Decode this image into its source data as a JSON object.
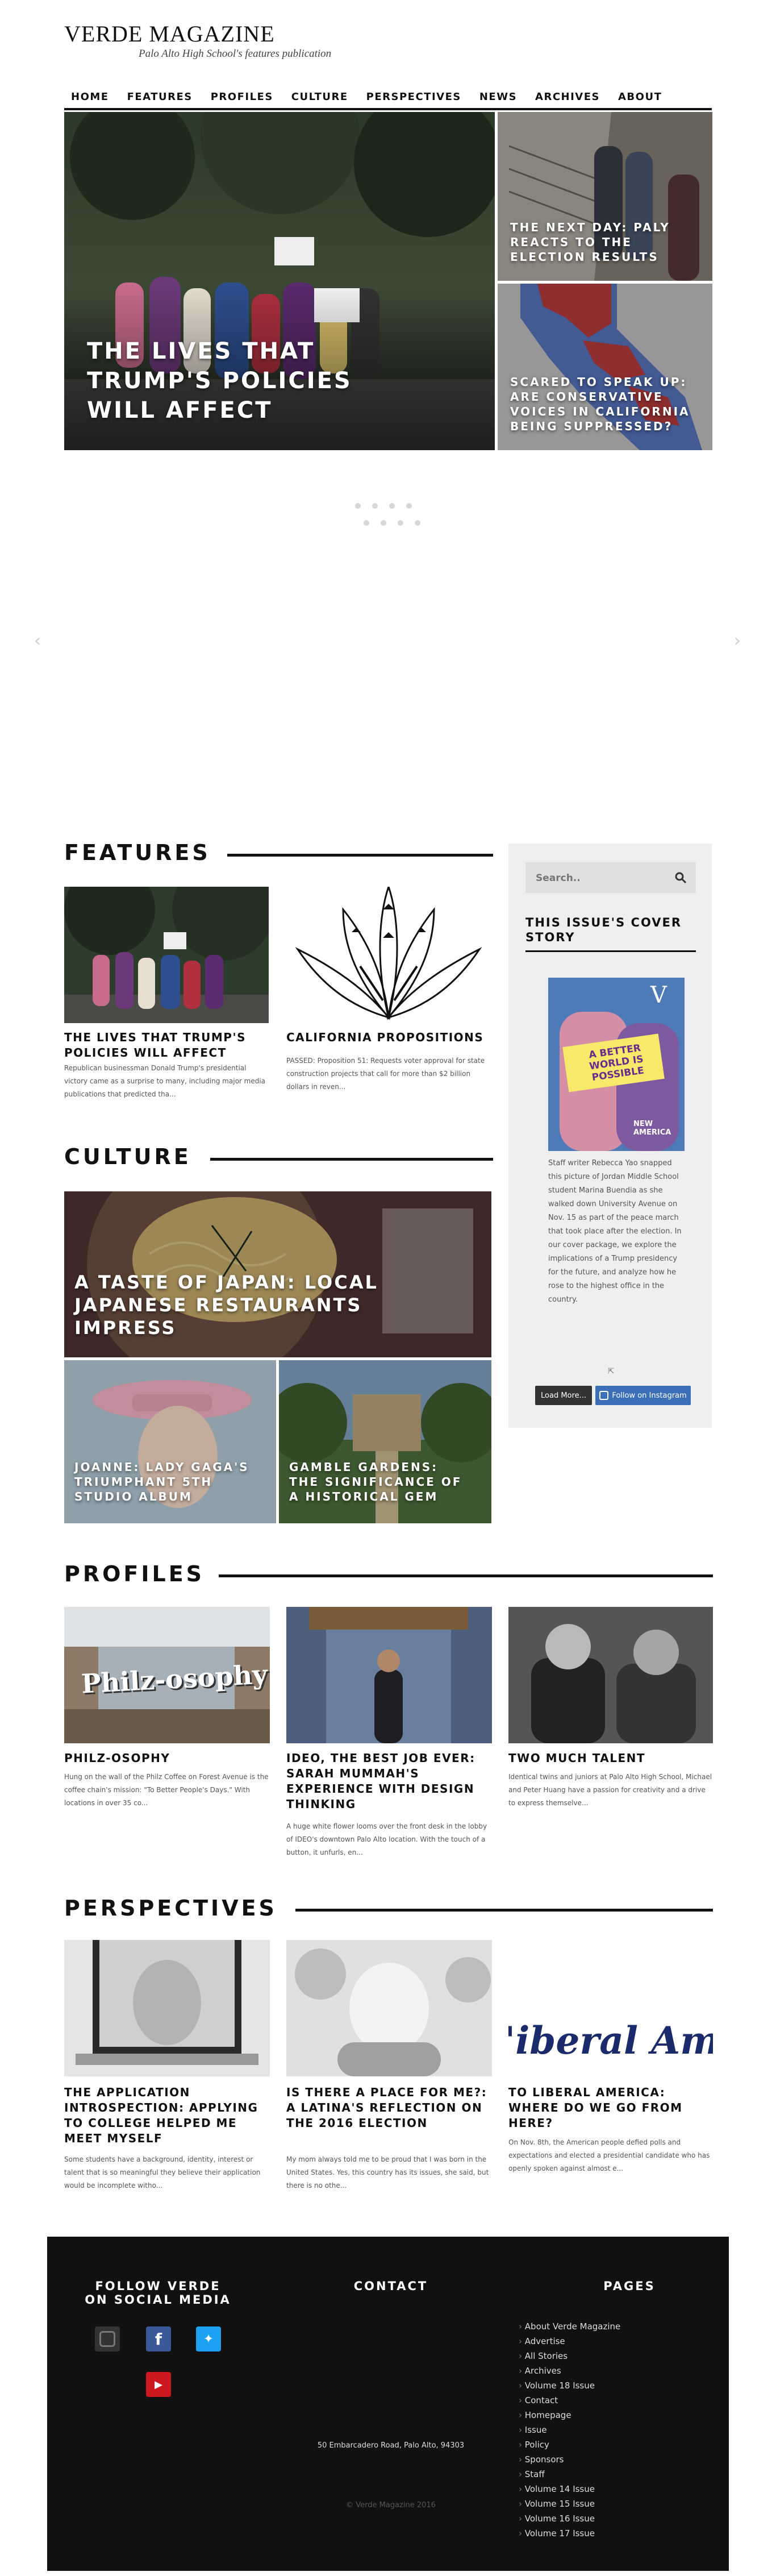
{
  "masthead": {
    "logo": "VERDE MAGAZINE",
    "tagline": "Palo Alto High School's features publication"
  },
  "nav": [
    "HOME",
    "FEATURES",
    "PROFILES",
    "CULTURE",
    "PERSPECTIVES",
    "NEWS",
    "ARCHIVES",
    "ABOUT"
  ],
  "hero": {
    "main": "THE LIVES THAT TRUMP'S POLICIES WILL AFFECT",
    "side1": "THE NEXT DAY: PALY REACTS TO THE ELECTION RESULTS",
    "side2": "SCARED TO SPEAK UP: ARE CONSERVATIVE VOICES IN CALIFORNIA BEING SUPPRESSED?"
  },
  "slider": {
    "prev": "‹",
    "next": "›"
  },
  "features": {
    "heading": "FEATURES",
    "cards": [
      {
        "title": "THE LIVES THAT TRUMP'S POLICIES WILL AFFECT",
        "excerpt": "Republican businessman Donald Trump's presidential victory came as a surprise to many, including major media publications that predicted tha..."
      },
      {
        "title": "CALIFORNIA PROPOSITIONS",
        "excerpt": "PASSED: Proposition 51: Requests voter approval for state construction projects that call for more than $2 billion dollars in reven..."
      }
    ]
  },
  "culture": {
    "heading": "CULTURE",
    "main": "A TASTE OF JAPAN: LOCAL JAPANESE RESTAURANTS IMPRESS",
    "left": "JOANNE: LADY GAGA'S TRIUMPHANT 5TH STUDIO ALBUM",
    "right": "GAMBLE GARDENS: THE SIGNIFICANCE OF A HISTORICAL GEM"
  },
  "sidebar": {
    "search_placeholder": "Search..",
    "cover_heading": "THIS ISSUE'S COVER STORY",
    "cover_text": "Staff writer Rebecca Yao snapped this picture of Jordan Middle School student Marina Buendia as she walked down University Avenue on Nov. 15 as part of the peace march that took place after the election. In our cover package, we explore the implications of a Trump presidency for the future, and analyze how he rose to the highest office in the country.",
    "cover_sign": "A BETTER WORLD IS POSSIBLE",
    "cover_letter": "V",
    "cover_badge": "NEW AMERICA",
    "load_more": "Load More...",
    "follow": "Follow on Instagram"
  },
  "profiles": {
    "heading": "PROFILES",
    "cards": [
      {
        "title": "PHILZ-OSOPHY",
        "excerpt": "Hung on the wall of the Philz Coffee on Forest Avenue is the coffee chain's mission: \"To Better People's Days.\" With locations in over 35 co...",
        "sign": "Philz-osophy"
      },
      {
        "title": "IDEO, THE BEST JOB EVER: SARAH MUMMAH'S EXPERIENCE WITH DESIGN THINKING",
        "excerpt": "A huge white flower looms over the front desk in the lobby of IDEO's downtown Palo Alto location. With the touch of a button, it unfurls, en..."
      },
      {
        "title": "TWO MUCH TALENT",
        "excerpt": "Identical twins and juniors at Palo Alto High School, Michael and Peter Huang have a passion for creativity and a drive to express themselve..."
      }
    ]
  },
  "perspectives": {
    "heading": "PERSPECTIVES",
    "cards": [
      {
        "title": "THE APPLICATION INTROSPECTION: APPLYING TO COLLEGE HELPED ME MEET MYSELF",
        "excerpt": "Some students have a background, identity, interest or talent that is so meaningful they believe their application would be incomplete witho..."
      },
      {
        "title": "IS THERE A PLACE FOR ME?: A LATINA'S REFLECTION ON THE 2016 ELECTION",
        "excerpt": "My mom always told me to be proud that I was born in the United States. Yes, this country has its issues, she said, but there is no othe..."
      },
      {
        "title": "TO LIBERAL AMERICA: WHERE DO WE GO FROM HERE?",
        "excerpt": "On Nov. 8th, the American people defied polls and expectations and elected a presidential candidate who has openly spoken against almost e...",
        "script": "'iberal Am"
      }
    ]
  },
  "footer": {
    "social_heading": "FOLLOW VERDE ON SOCIAL MEDIA",
    "contact_heading": "CONTACT",
    "pages_heading": "PAGES",
    "address": "50 Embarcadero Road, Palo Alto, 94303",
    "copyright": "© Verde Magazine 2016",
    "pages": [
      "About Verde Magazine",
      "Advertise",
      "All Stories",
      "Archives",
      "Volume 18 Issue",
      "Contact",
      "Homepage",
      "Issue",
      "Policy",
      "Sponsors",
      "Staff",
      "Volume 14 Issue",
      "Volume 15 Issue",
      "Volume 16 Issue",
      "Volume 17 Issue"
    ]
  },
  "colors": {
    "accent_blue": "#3b6fb6",
    "twitter": "#1da1f2",
    "facebook": "#3b5998",
    "youtube": "#cc181e",
    "dark": "#111111"
  }
}
